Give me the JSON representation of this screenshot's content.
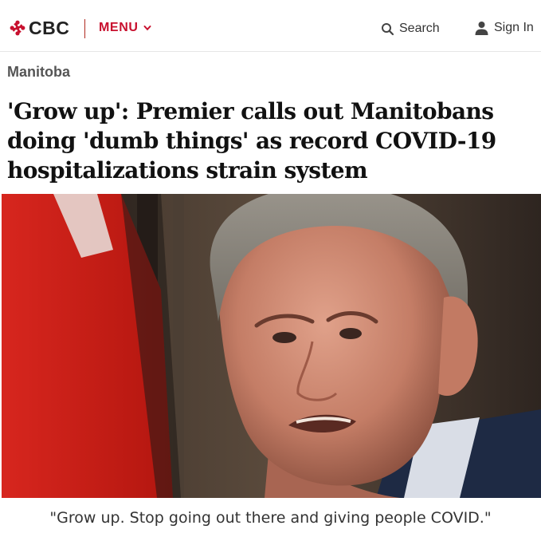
{
  "header": {
    "logo_text": "CBC",
    "menu_label": "MENU",
    "search_label": "Search",
    "signin_label": "Sign In"
  },
  "article": {
    "section": "Manitoba",
    "headline": "'Grow up': Premier calls out Manitobans doing 'dumb things' as record COVID-19 hospitalizations strain system",
    "caption": "\"Grow up. Stop going out there and giving people COVID.\""
  },
  "icons": {
    "logo": "cbc-gem-icon",
    "menu": "chevron-down-icon",
    "search": "search-icon",
    "signin": "user-icon"
  },
  "colors": {
    "brand_red": "#c8102e",
    "text": "#111111",
    "section_gray": "#555555"
  }
}
